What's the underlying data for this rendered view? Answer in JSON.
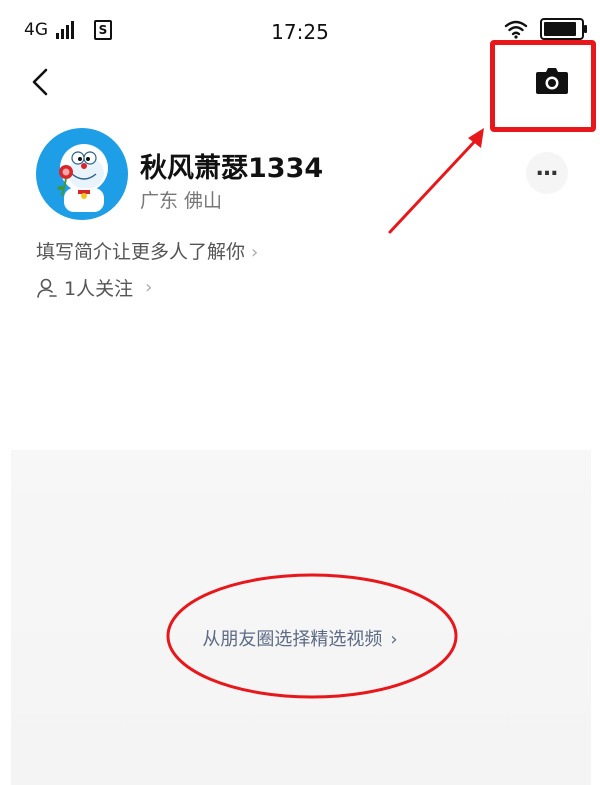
{
  "status_bar": {
    "network": "4G",
    "sim_label": "S",
    "time": "17:25"
  },
  "profile": {
    "name": "秋风萧瑟1334",
    "location": "广东 佛山",
    "bio_prompt": "填写简介让更多人了解你",
    "follow_text": "1人关注"
  },
  "featured": {
    "link_text": "从朋友圈选择精选视频"
  },
  "icons": {
    "back": "chevron-left-icon",
    "camera": "camera-icon",
    "more": "more-dots-icon",
    "person": "person-icon",
    "wifi": "wifi-icon",
    "battery": "battery-icon",
    "signal": "signal-icon"
  },
  "colors": {
    "annotation_red": "#e8171b",
    "link_blue_gray": "#5d6b85",
    "avatar_blue": "#1e9ee6"
  },
  "battery_level": 0.9
}
